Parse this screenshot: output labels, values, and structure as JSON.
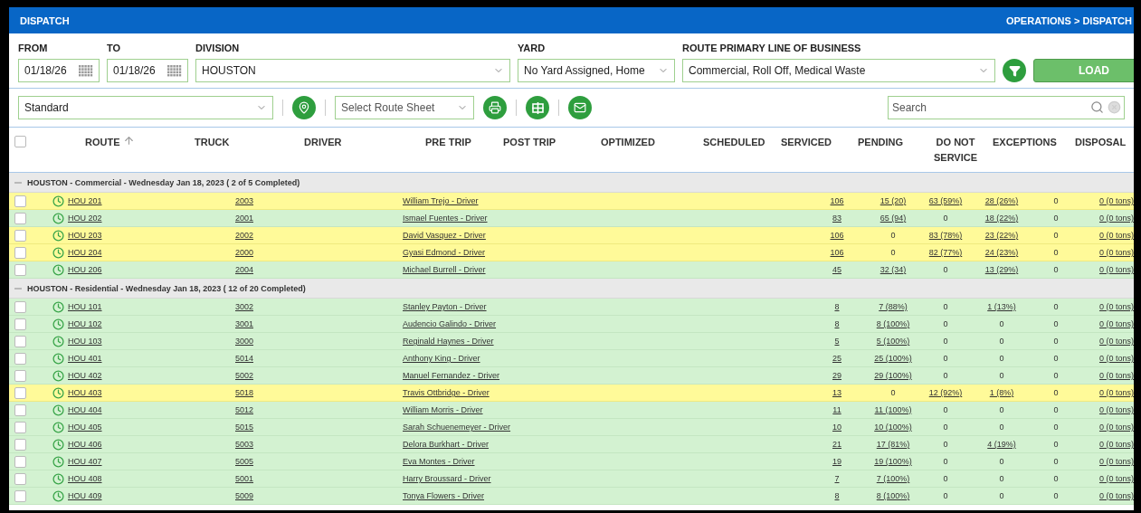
{
  "header": {
    "title": "DISPATCH",
    "breadcrumb": "OPERATIONS > DISPATCH"
  },
  "filters": {
    "from": {
      "label": "FROM",
      "value": "01/18/26"
    },
    "to": {
      "label": "TO",
      "value": "01/18/26"
    },
    "division": {
      "label": "DIVISION",
      "value": "HOUSTON"
    },
    "yard": {
      "label": "YARD",
      "value": "No Yard Assigned, Home"
    },
    "line_of_business": {
      "label": "ROUTE PRIMARY LINE OF BUSINESS",
      "value": "Commercial, Roll Off, Medical Waste"
    },
    "load_button": "LOAD"
  },
  "toolbar": {
    "view": "Standard",
    "route_sheet": {
      "placeholder": "Select Route Sheet"
    },
    "search": {
      "placeholder": "Search"
    }
  },
  "table": {
    "select_all_checked": false,
    "columns": [
      {
        "label": "ROUTE",
        "sorted": true
      },
      {
        "label": "TRUCK",
        "sorted": false
      },
      {
        "label": "DRIVER",
        "sorted": false
      },
      {
        "label": "PRE TRIP",
        "sorted": false
      },
      {
        "label": "POST TRIP",
        "sorted": false
      },
      {
        "label": "OPTIMIZED",
        "sorted": false
      },
      {
        "label": "SCHEDULED",
        "sorted": false
      },
      {
        "label": "SERVICED",
        "sorted": false
      },
      {
        "label": "PENDING",
        "sorted": false
      },
      {
        "label": "DO NOT SERVICE",
        "sorted": false
      },
      {
        "label": "EXCEPTIONS",
        "sorted": false
      },
      {
        "label": "DISPOSAL",
        "sorted": false
      }
    ],
    "groups": [
      {
        "title": "HOUSTON - Commercial - Wednesday Jan 18, 2023 ( 2 of 5 Completed)",
        "expanded": true,
        "rows": [
          {
            "route": "HOU 201",
            "truck": "2003",
            "driver": "William Trejo - Driver",
            "completed": false,
            "checked": false,
            "values": [
              "106",
              "15 (20)",
              "63 (59%)",
              "28 (26%)",
              "0",
              "0 (0 tons)"
            ],
            "links": [
              true,
              true,
              true,
              true,
              false,
              true
            ]
          },
          {
            "route": "HOU 202",
            "truck": "2001",
            "driver": "Ismael Fuentes - Driver",
            "completed": true,
            "checked": false,
            "values": [
              "83",
              "65 (94)",
              "0",
              "18 (22%)",
              "0",
              "0 (0 tons)"
            ],
            "links": [
              true,
              true,
              false,
              true,
              false,
              true
            ]
          },
          {
            "route": "HOU 203",
            "truck": "2002",
            "driver": "David Vasquez - Driver",
            "completed": false,
            "checked": false,
            "values": [
              "106",
              "0",
              "83 (78%)",
              "23 (22%)",
              "0",
              "0 (0 tons)"
            ],
            "links": [
              true,
              false,
              true,
              true,
              false,
              true
            ]
          },
          {
            "route": "HOU 204",
            "truck": "2000",
            "driver": "Gyasi Edmond - Driver",
            "completed": false,
            "checked": false,
            "values": [
              "106",
              "0",
              "82 (77%)",
              "24 (23%)",
              "0",
              "0 (0 tons)"
            ],
            "links": [
              true,
              false,
              true,
              true,
              false,
              true
            ]
          },
          {
            "route": "HOU 206",
            "truck": "2004",
            "driver": "Michael Burrell - Driver",
            "completed": true,
            "checked": false,
            "values": [
              "45",
              "32 (34)",
              "0",
              "13 (29%)",
              "0",
              "0 (0 tons)"
            ],
            "links": [
              true,
              true,
              false,
              true,
              false,
              true
            ]
          }
        ]
      },
      {
        "title": "HOUSTON - Residential - Wednesday Jan 18, 2023 ( 12 of 20 Completed)",
        "expanded": true,
        "rows": [
          {
            "route": "HOU 101",
            "truck": "3002",
            "driver": "Stanley Payton - Driver",
            "completed": true,
            "checked": false,
            "values": [
              "8",
              "7 (88%)",
              "0",
              "1 (13%)",
              "0",
              "0 (0 tons)"
            ],
            "links": [
              true,
              true,
              false,
              true,
              false,
              true
            ]
          },
          {
            "route": "HOU 102",
            "truck": "3001",
            "driver": "Audencio Galindo - Driver",
            "completed": true,
            "checked": false,
            "values": [
              "8",
              "8 (100%)",
              "0",
              "0",
              "0",
              "0 (0 tons)"
            ],
            "links": [
              true,
              true,
              false,
              false,
              false,
              true
            ]
          },
          {
            "route": "HOU 103",
            "truck": "3000",
            "driver": "Reginald Haynes - Driver",
            "completed": true,
            "checked": false,
            "values": [
              "5",
              "5 (100%)",
              "0",
              "0",
              "0",
              "0 (0 tons)"
            ],
            "links": [
              true,
              true,
              false,
              false,
              false,
              true
            ]
          },
          {
            "route": "HOU 401",
            "truck": "5014",
            "driver": "Anthony King - Driver",
            "completed": true,
            "checked": false,
            "values": [
              "25",
              "25 (100%)",
              "0",
              "0",
              "0",
              "0 (0 tons)"
            ],
            "links": [
              true,
              true,
              false,
              false,
              false,
              true
            ]
          },
          {
            "route": "HOU 402",
            "truck": "5002",
            "driver": "Manuel Fernandez - Driver",
            "completed": true,
            "checked": false,
            "values": [
              "29",
              "29 (100%)",
              "0",
              "0",
              "0",
              "0 (0 tons)"
            ],
            "links": [
              true,
              true,
              false,
              false,
              false,
              true
            ]
          },
          {
            "route": "HOU 403",
            "truck": "5018",
            "driver": "Travis Ottbridge - Driver",
            "completed": false,
            "checked": false,
            "values": [
              "13",
              "0",
              "12 (92%)",
              "1 (8%)",
              "0",
              "0 (0 tons)"
            ],
            "links": [
              true,
              false,
              true,
              true,
              false,
              true
            ]
          },
          {
            "route": "HOU 404",
            "truck": "5012",
            "driver": "William Morris - Driver",
            "completed": true,
            "checked": false,
            "values": [
              "11",
              "11 (100%)",
              "0",
              "0",
              "0",
              "0 (0 tons)"
            ],
            "links": [
              true,
              true,
              false,
              false,
              false,
              true
            ]
          },
          {
            "route": "HOU 405",
            "truck": "5015",
            "driver": "Sarah Schuenemeyer - Driver",
            "completed": true,
            "checked": false,
            "values": [
              "10",
              "10 (100%)",
              "0",
              "0",
              "0",
              "0 (0 tons)"
            ],
            "links": [
              true,
              true,
              false,
              false,
              false,
              true
            ]
          },
          {
            "route": "HOU 406",
            "truck": "5003",
            "driver": "Delora Burkhart - Driver",
            "completed": true,
            "checked": false,
            "values": [
              "21",
              "17 (81%)",
              "0",
              "4 (19%)",
              "0",
              "0 (0 tons)"
            ],
            "links": [
              true,
              true,
              false,
              true,
              false,
              true
            ]
          },
          {
            "route": "HOU 407",
            "truck": "5005",
            "driver": "Eva Montes - Driver",
            "completed": true,
            "checked": false,
            "values": [
              "19",
              "19 (100%)",
              "0",
              "0",
              "0",
              "0 (0 tons)"
            ],
            "links": [
              true,
              true,
              false,
              false,
              false,
              true
            ]
          },
          {
            "route": "HOU 408",
            "truck": "5001",
            "driver": "Harry Broussard - Driver",
            "completed": true,
            "checked": false,
            "values": [
              "7",
              "7 (100%)",
              "0",
              "0",
              "0",
              "0 (0 tons)"
            ],
            "links": [
              true,
              true,
              false,
              false,
              false,
              true
            ]
          },
          {
            "route": "HOU 409",
            "truck": "5009",
            "driver": "Tonya Flowers - Driver",
            "completed": true,
            "checked": false,
            "values": [
              "8",
              "8 (100%)",
              "0",
              "0",
              "0",
              "0 (0 tons)"
            ],
            "links": [
              true,
              true,
              false,
              false,
              false,
              true
            ]
          }
        ]
      }
    ]
  }
}
